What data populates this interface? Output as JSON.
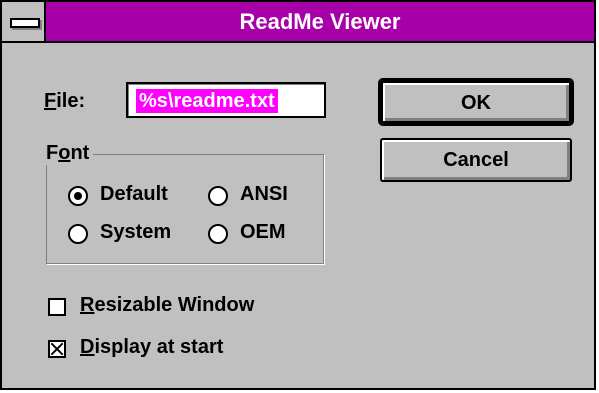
{
  "window": {
    "title": "ReadMe Viewer"
  },
  "file": {
    "label_accel": "F",
    "label_rest": "ile:",
    "value": "%s\\readme.txt"
  },
  "buttons": {
    "ok": "OK",
    "cancel": "Cancel"
  },
  "font_group": {
    "title_pre": "F",
    "title_accel": "o",
    "title_post": "nt",
    "options": [
      {
        "label": "Default",
        "selected": true
      },
      {
        "label": "ANSI",
        "selected": false
      },
      {
        "label": "System",
        "selected": false
      },
      {
        "label": "OEM",
        "selected": false
      }
    ]
  },
  "checkboxes": [
    {
      "accel": "R",
      "rest": "esizable Window",
      "checked": false
    },
    {
      "accel": "D",
      "rest": "isplay at start",
      "checked": true
    }
  ]
}
